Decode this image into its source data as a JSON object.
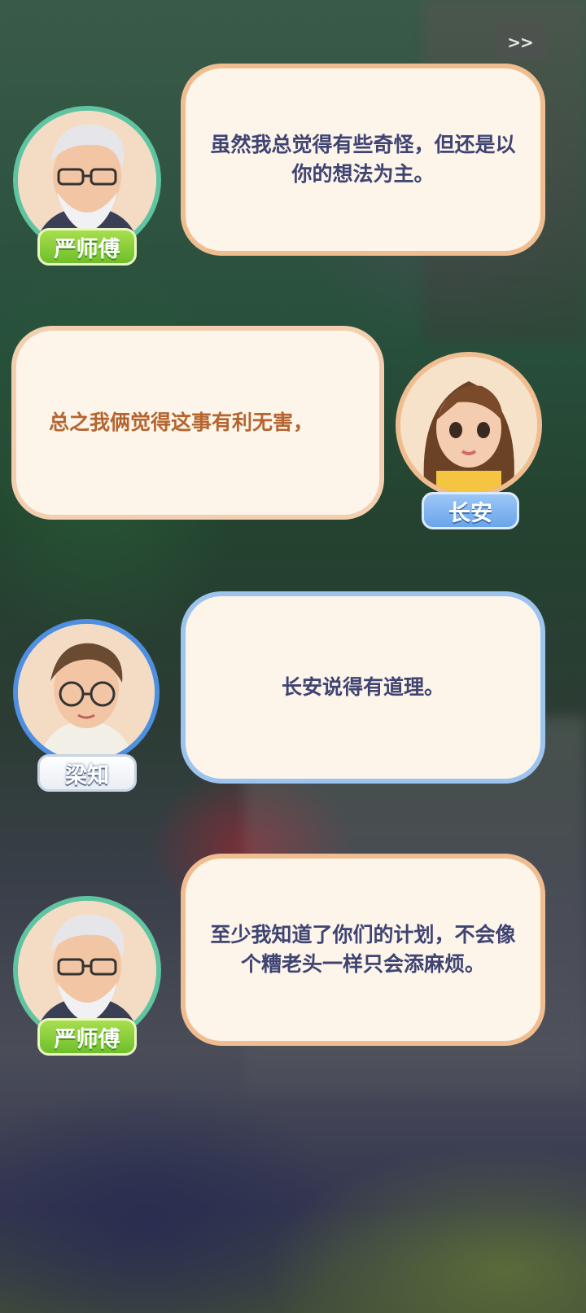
{
  "skip_button": {
    "label": ">>"
  },
  "dialogue": [
    {
      "speaker": "严师傅",
      "text": "虽然我总觉得有些奇怪，但还是以你的想法为主。"
    },
    {
      "speaker": "长安",
      "text": "总之我俩觉得这事有利无害，"
    },
    {
      "speaker": "梁知",
      "text": "长安说得有道理。"
    },
    {
      "speaker": "严师傅",
      "text": "至少我知道了你们的计划，不会像个糟老头一样只会添麻烦。"
    }
  ],
  "colors": {
    "bubble_fill": "#fdf5ea",
    "bubble_border_orange": "#f0bd90",
    "bubble_border_blue": "#9dc4ee",
    "text_navy": "#3f4473",
    "text_brown": "#b5652f",
    "tag_green": "#7cc631",
    "tag_blue": "#7aaeee"
  }
}
